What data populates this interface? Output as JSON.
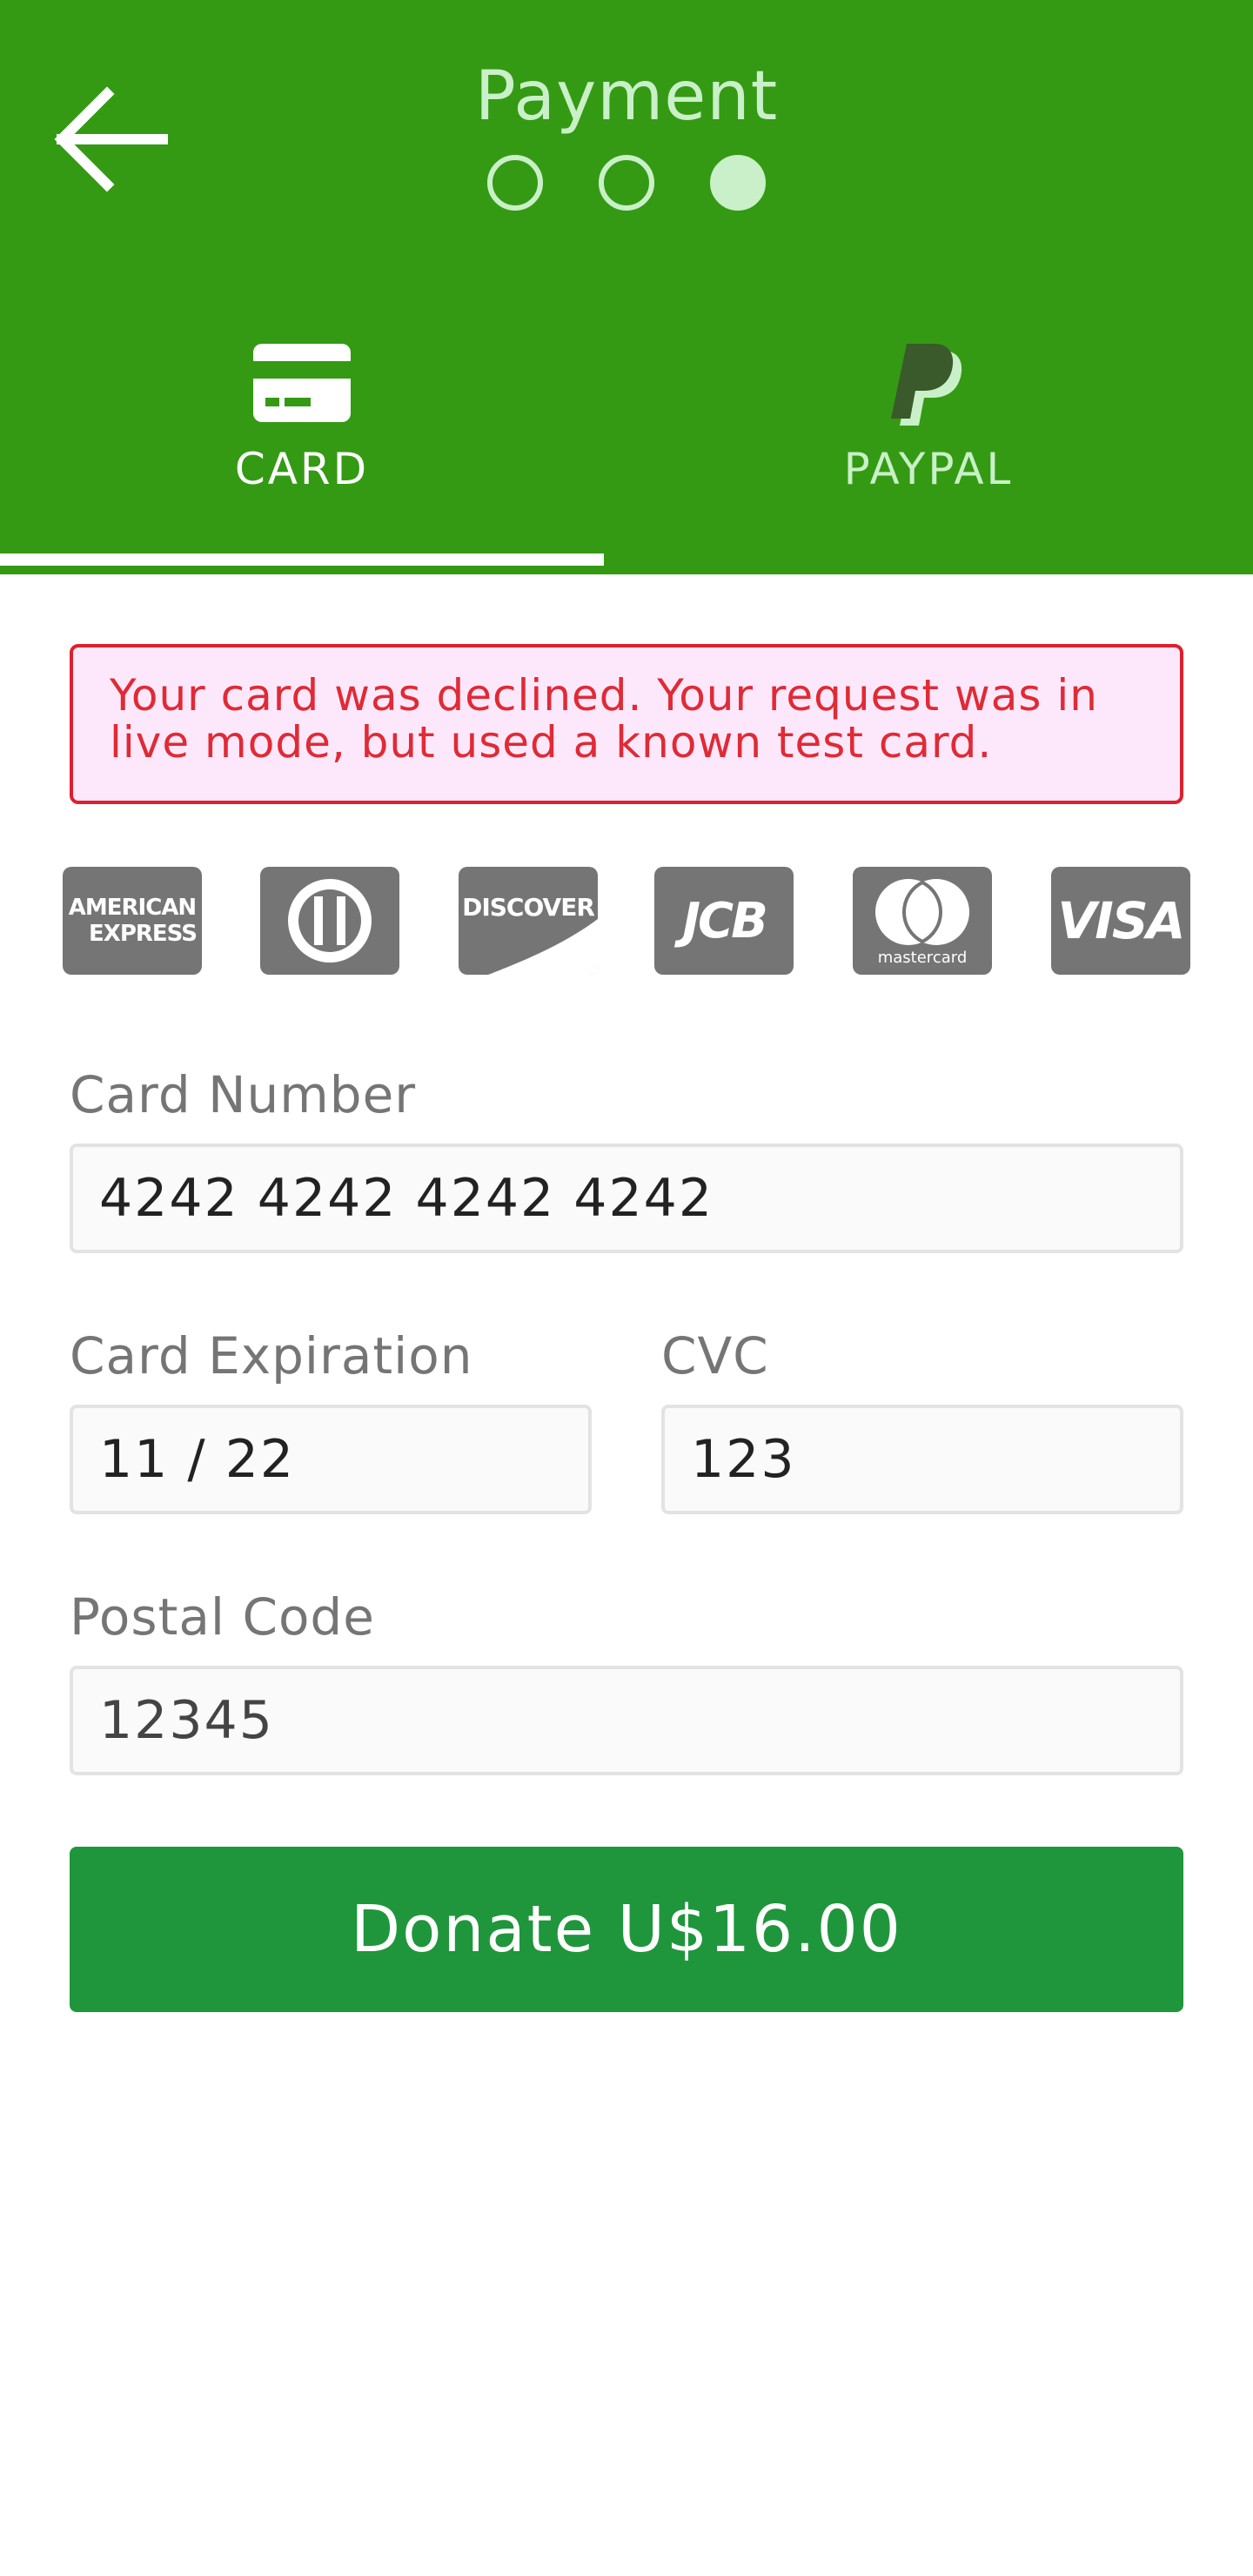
{
  "header": {
    "title": "Payment",
    "steps": {
      "total": 3,
      "current": 3
    },
    "back_icon": "arrow-left-icon"
  },
  "tabs": [
    {
      "label": "CARD",
      "icon": "credit-card-icon",
      "selected": true
    },
    {
      "label": "PAYPAL",
      "icon": "paypal-icon",
      "selected": false
    }
  ],
  "error": {
    "line1": "Your card was declined. Your request was in",
    "line2": "live mode, but used a known test card."
  },
  "brands": {
    "amex_line1": "AMERICAN",
    "amex_line2": "EXPRESS",
    "discover": "DISCOVER",
    "jcb": "JCB",
    "mastercard": "mastercard",
    "visa": "VISA"
  },
  "form": {
    "card_number_label": "Card Number",
    "card_number_value": "4242 4242 4242 4242",
    "expiration_label": "Card Expiration",
    "expiration_value": "11 / 22",
    "cvc_label": "CVC",
    "cvc_value": "123",
    "postal_label": "Postal Code",
    "postal_value": "12345"
  },
  "donate_button": "Donate U$16.00",
  "colors": {
    "header_green": "#349a13",
    "header_text": "#c9f0c8",
    "button_green": "#1f963c",
    "error_red": "#df1f2d",
    "error_bg": "#fde8fb",
    "brand_gray": "#757575"
  }
}
